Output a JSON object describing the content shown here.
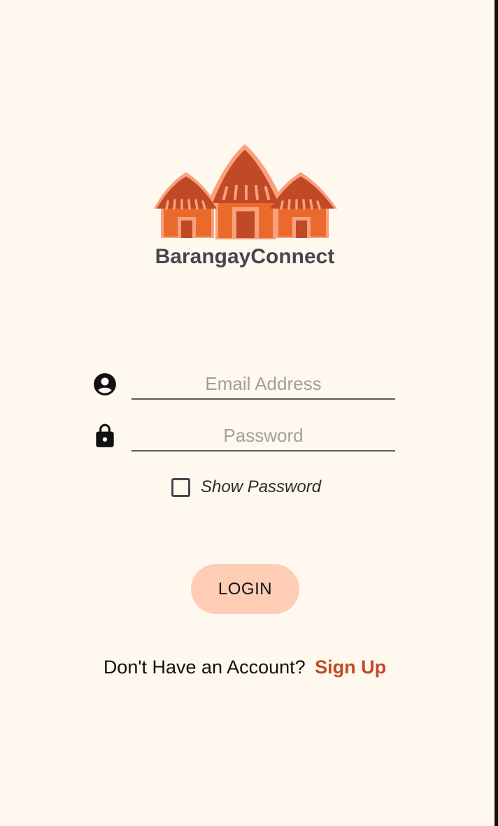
{
  "app": {
    "name": "BarangayConnect"
  },
  "login_form": {
    "email_placeholder": "Email Address",
    "email_value": "",
    "password_placeholder": "Password",
    "password_value": "",
    "show_password_label": "Show Password",
    "show_password_checked": false,
    "login_label": "LOGIN"
  },
  "signup": {
    "prompt": "Don't Have an Account?",
    "link_label": "Sign Up"
  },
  "icons": {
    "logo": "nipa-huts-logo",
    "email": "account-circle-icon",
    "password": "lock-icon"
  },
  "colors": {
    "background": "#FEF8EE",
    "brand_orange": "#EA6A2C",
    "brand_dark": "#C14A26",
    "button": "#FFCCB6",
    "text_dark": "#49454F"
  }
}
